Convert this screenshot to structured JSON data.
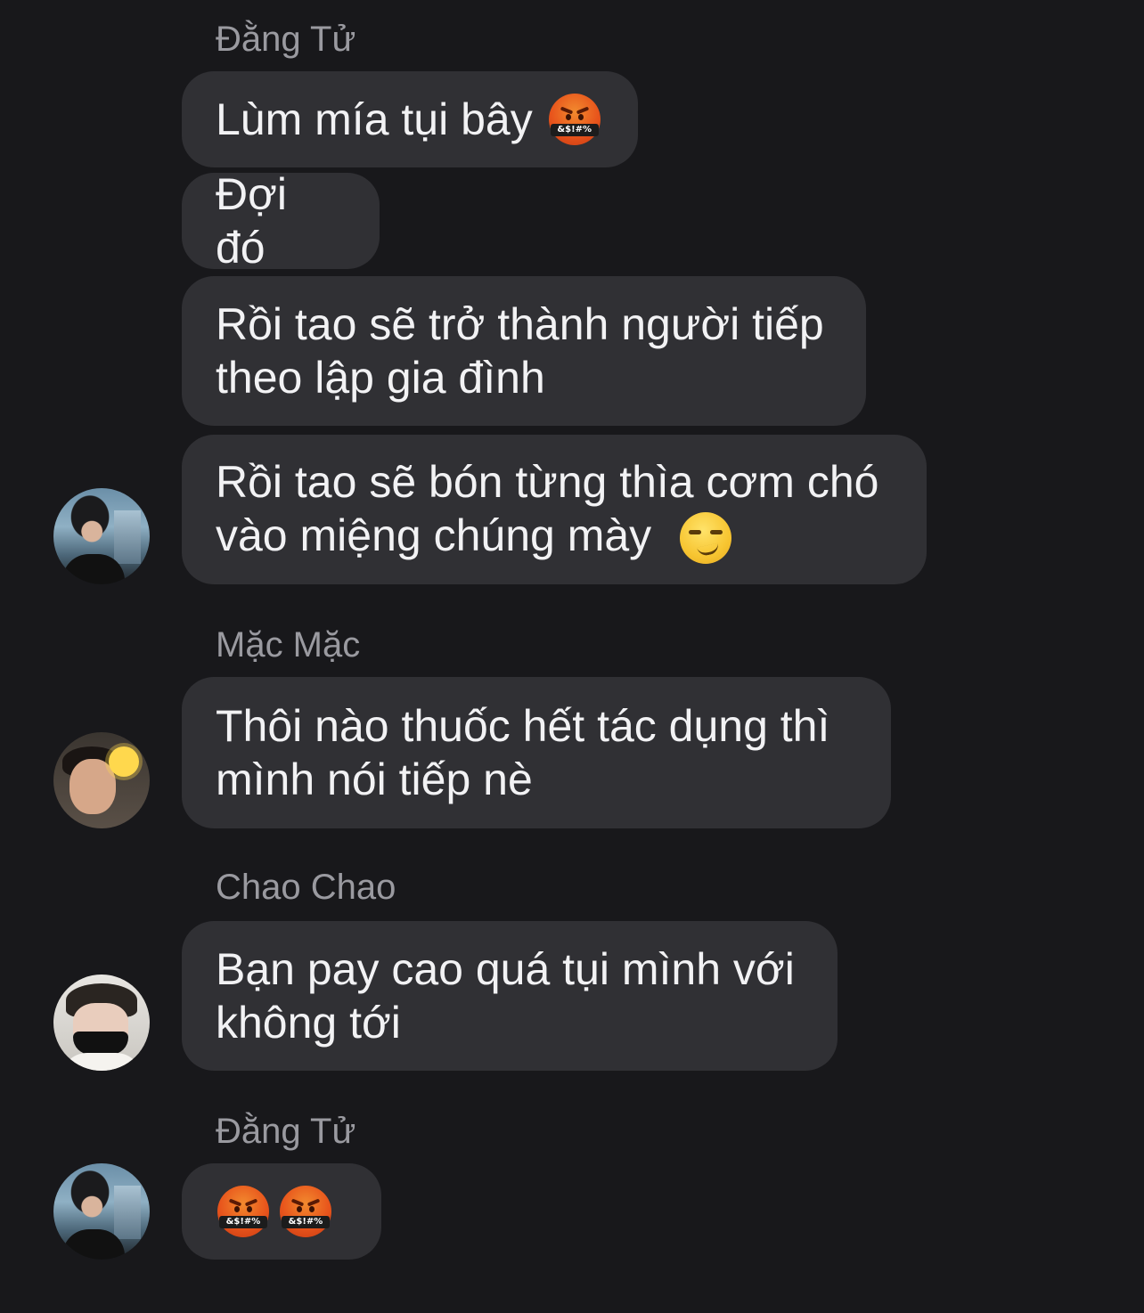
{
  "chat": {
    "groups": [
      {
        "sender": "Đằng Tử",
        "messages": [
          {
            "text": "Lùm mía tụi bây",
            "emoji": "enraged-face-with-symbols"
          },
          {
            "text": "Đợi đó"
          },
          {
            "text": "Rồi tao sẽ trở thành người tiếp theo lập gia đình"
          },
          {
            "text": "Rồi tao sẽ bón từng thìa cơm chó vào miệng chúng mày",
            "emoji": "smirking-face"
          }
        ],
        "avatar": "avatar-dang-tu"
      },
      {
        "sender": "Mặc Mặc",
        "messages": [
          {
            "text": "Thôi nào thuốc hết tác dụng thì mình nói tiếp nè"
          }
        ],
        "avatar": "avatar-mac-mac"
      },
      {
        "sender": "Chao Chao",
        "messages": [
          {
            "text": "Bạn pay cao quá tụi mình với không tới"
          }
        ],
        "avatar": "avatar-chao-chao"
      },
      {
        "sender": "Đằng Tử",
        "messages": [
          {
            "emojis": [
              "enraged-face-with-symbols",
              "enraged-face-with-symbols"
            ]
          }
        ],
        "avatar": "avatar-dang-tu"
      }
    ],
    "emoji_symbol_text": "&$!#%",
    "colors": {
      "background": "#18181b",
      "bubble": "#303034",
      "text": "#f2f2f4",
      "sender": "#9a9aa0"
    }
  }
}
